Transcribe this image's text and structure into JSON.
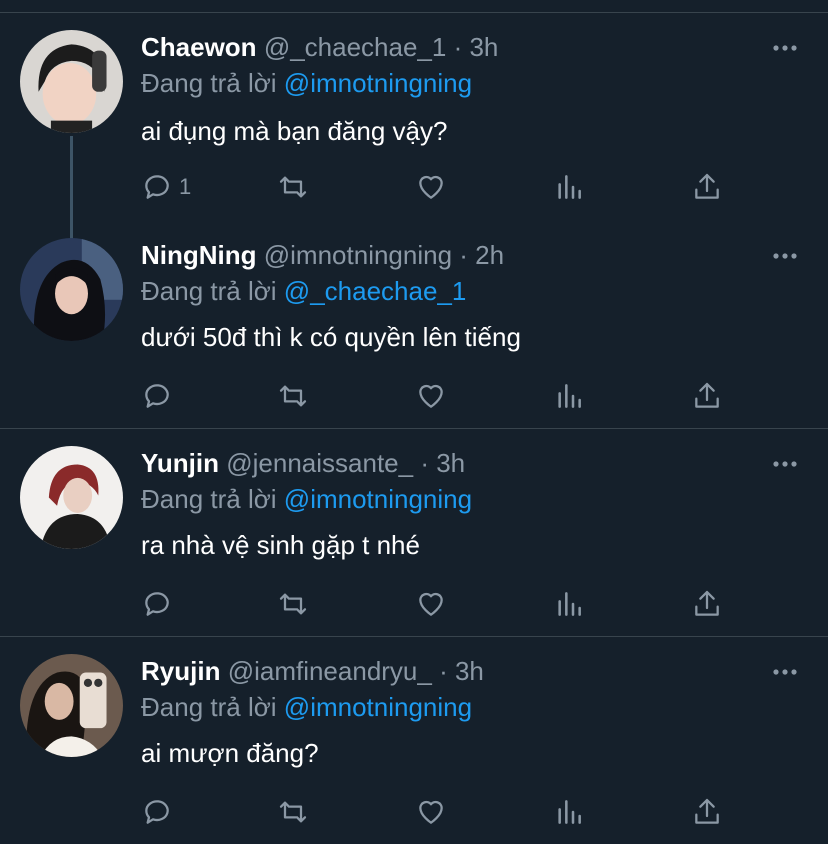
{
  "tweets": [
    {
      "name": "Chaewon",
      "handle": "@_chaechae_1",
      "time": "· 3h",
      "reply_prefix": "Đang trả lời",
      "reply_to": "@imnotningning",
      "text": "ai đụng mà bạn đăng vậy?",
      "reply_count": "1",
      "avatar_colors": [
        "#d9d6d2",
        "#1c1c1c",
        "#f1d3c4"
      ]
    },
    {
      "name": "NingNing",
      "handle": "@imnotningning",
      "time": "· 2h",
      "reply_prefix": "Đang trả lời",
      "reply_to": "@_chaechae_1",
      "text": "dưới 50đ thì k có quyền lên tiếng",
      "reply_count": "",
      "avatar_colors": [
        "#2a3a5a",
        "#0e0f14",
        "#e9c7b8"
      ]
    },
    {
      "name": "Yunjin",
      "handle": "@jennaissante_",
      "time": "· 3h",
      "reply_prefix": "Đang trả lời",
      "reply_to": "@imnotningning",
      "text": "ra nhà vệ sinh gặp t nhé",
      "reply_count": "",
      "avatar_colors": [
        "#f2f0ee",
        "#8a2a2a",
        "#1b1b1b"
      ]
    },
    {
      "name": "Ryujin",
      "handle": "@iamfineandryu_",
      "time": "· 3h",
      "reply_prefix": "Đang trả lời",
      "reply_to": "@imnotningning",
      "text": "ai mượn đăng?",
      "reply_count": "",
      "avatar_colors": [
        "#6b5a4e",
        "#1a1512",
        "#e8ddd3"
      ]
    }
  ],
  "icons": {
    "reply": "reply-icon",
    "retweet": "retweet-icon",
    "like": "heart-icon",
    "analytics": "analytics-icon",
    "share": "share-icon",
    "more": "more-icon"
  },
  "colors": {
    "background": "#15202b",
    "mention": "#1d9bf0",
    "muted": "#8b98a5",
    "divider": "#38444d"
  }
}
